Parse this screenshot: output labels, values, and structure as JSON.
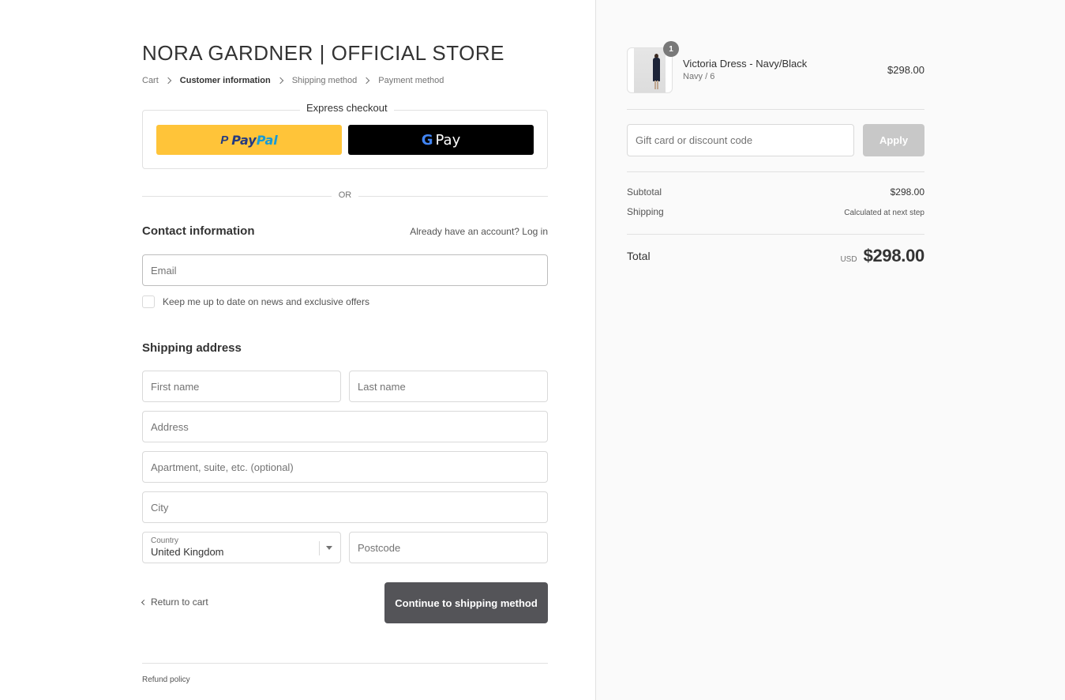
{
  "store": {
    "title": "NORA GARDNER | OFFICIAL STORE"
  },
  "breadcrumb": [
    {
      "label": "Cart",
      "active": false
    },
    {
      "label": "Customer information",
      "active": true
    },
    {
      "label": "Shipping method",
      "active": false
    },
    {
      "label": "Payment method",
      "active": false
    }
  ],
  "express_checkout": {
    "label": "Express checkout",
    "paypal": {
      "pay": "Pay",
      "pal": "Pal"
    },
    "gpay": {
      "g": "G",
      "label": "Pay"
    }
  },
  "divider": {
    "or": "OR"
  },
  "contact": {
    "title": "Contact information",
    "login_prompt": "Already have an account?",
    "login_link": "Log in",
    "email_placeholder": "Email",
    "newsletter_label": "Keep me up to date on news and exclusive offers"
  },
  "shipping": {
    "title": "Shipping address",
    "first_name_placeholder": "First name",
    "last_name_placeholder": "Last name",
    "address_placeholder": "Address",
    "apartment_placeholder": "Apartment, suite, etc. (optional)",
    "city_placeholder": "City",
    "country_label": "Country",
    "country_value": "United Kingdom",
    "postcode_placeholder": "Postcode"
  },
  "actions": {
    "return_label": "Return to cart",
    "continue_label": "Continue to shipping method"
  },
  "footer": {
    "refund_policy": "Refund policy"
  },
  "order": {
    "product": {
      "name": "Victoria Dress - Navy/Black",
      "variant": "Navy / 6",
      "price": "$298.00",
      "quantity": "1"
    },
    "discount": {
      "placeholder": "Gift card or discount code",
      "apply_label": "Apply"
    },
    "subtotal": {
      "label": "Subtotal",
      "value": "$298.00"
    },
    "shipping": {
      "label": "Shipping",
      "value": "Calculated at next step"
    },
    "total": {
      "label": "Total",
      "currency": "USD",
      "value": "$298.00"
    }
  },
  "colors": {
    "paypal_yellow": "#ffc439",
    "gpay_black": "#000000",
    "continue_button": "#545458",
    "apply_button": "#c8c8c8",
    "sidebar_bg": "#fafafa"
  }
}
